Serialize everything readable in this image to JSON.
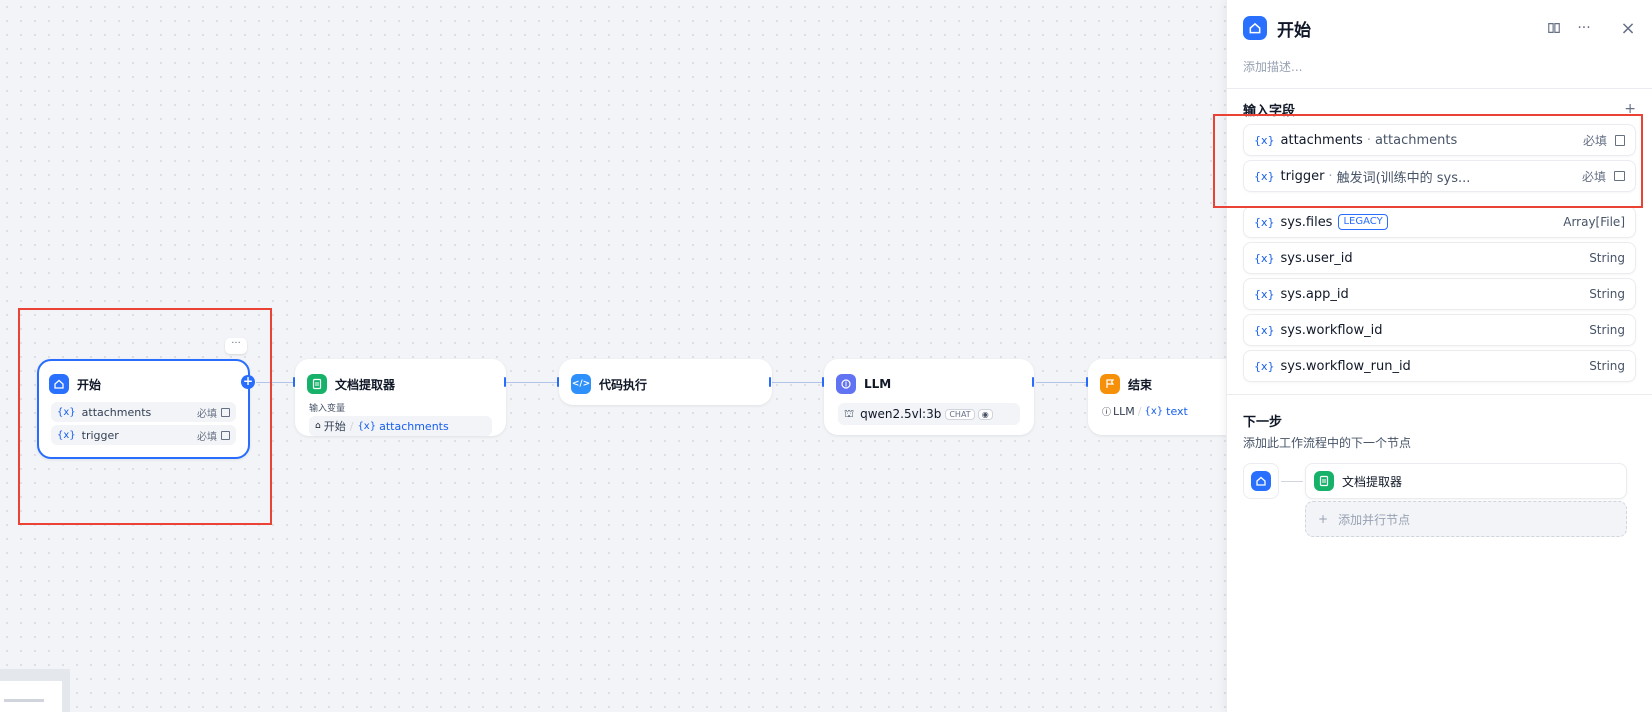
{
  "canvas": {
    "start_node": {
      "title": "开始",
      "more": "···",
      "vars": [
        {
          "x": "{x}",
          "name": "attachments",
          "req": "必填"
        },
        {
          "x": "{x}",
          "name": "trigger",
          "req": "必填"
        }
      ]
    },
    "doc_node": {
      "title": "文档提取器",
      "input_label": "输入变量",
      "ref_node": "开始",
      "ref_x": "{x}",
      "ref_var": "attachments"
    },
    "code_node": {
      "title": "代码执行"
    },
    "llm_node": {
      "title": "LLM",
      "model": "qwen2.5vl:3b",
      "badge": "CHAT"
    },
    "end_node": {
      "title": "结束",
      "ref_node": "LLM",
      "ref_x": "{x}",
      "ref_var": "text"
    },
    "plus": "+"
  },
  "panel": {
    "title": "开始",
    "close": "×",
    "more": "···",
    "description_placeholder": "添加描述...",
    "input_fields_title": "输入字段",
    "add": "+",
    "fields": [
      {
        "x": "{x}",
        "name": "attachments",
        "label": "attachments",
        "sep": "·",
        "req": "必填"
      },
      {
        "x": "{x}",
        "name": "trigger",
        "label": "触发词(训练中的 sys...",
        "sep": "·",
        "req": "必填"
      }
    ],
    "sys_vars": [
      {
        "x": "{x}",
        "name": "sys.files",
        "badge": "LEGACY",
        "type": "Array[File]"
      },
      {
        "x": "{x}",
        "name": "sys.user_id",
        "type": "String"
      },
      {
        "x": "{x}",
        "name": "sys.app_id",
        "type": "String"
      },
      {
        "x": "{x}",
        "name": "sys.workflow_id",
        "type": "String"
      },
      {
        "x": "{x}",
        "name": "sys.workflow_run_id",
        "type": "String"
      }
    ],
    "next_step": {
      "title": "下一步",
      "subtitle": "添加此工作流程中的下一个节点",
      "node_title": "文档提取器",
      "add_parallel": "添加并行节点",
      "add_plus": "+"
    }
  },
  "colors": {
    "accent": "#296dff",
    "start_icon": "#2970ff",
    "doc_icon": "#17b26a",
    "code_icon": "#2e90fa",
    "llm_icon": "#6172f3",
    "end_icon": "#f79009",
    "highlight": "#ea4335"
  }
}
